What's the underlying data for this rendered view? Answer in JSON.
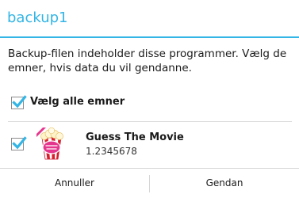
{
  "dialog": {
    "title": "backup1",
    "message": "Backup-filen indeholder disse programmer. Vælg de emner, hvis data du vil gendanne.",
    "accent_color": "#33b5e5"
  },
  "select_all": {
    "label": "Vælg alle emner",
    "checked": true
  },
  "apps": [
    {
      "name": "Guess The Movie",
      "version": "1.2345678",
      "icon": "guess-the-movie-icon",
      "checked": true
    }
  ],
  "buttons": {
    "cancel_label": "Annuller",
    "restore_label": "Gendan"
  }
}
